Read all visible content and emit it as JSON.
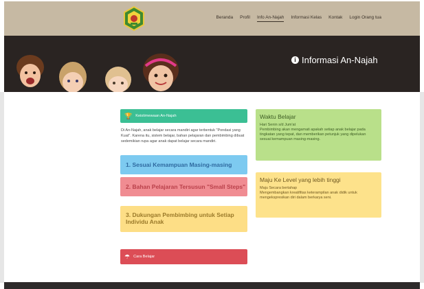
{
  "nav": {
    "items": [
      {
        "label": "Beranda",
        "active": false
      },
      {
        "label": "Profil",
        "active": false
      },
      {
        "label": "Info An-Najah",
        "active": true
      },
      {
        "label": "Informasi Kelas",
        "active": false
      },
      {
        "label": "Kontak",
        "active": false
      },
      {
        "label": "Login Orang tua",
        "active": false
      }
    ],
    "logo_icon": "school-logo-icon"
  },
  "hero": {
    "title": "Informasi An-Najah",
    "icon": "info-circle-icon"
  },
  "main": {
    "keunggulan_header": "Keistimewaan An-Najah",
    "description": "Di An-Najah, anak belajar secara mandiri agar terbentuk \"Pondasi yang Kuat\". Karena itu, sistem belajar, bahan pelajaran dan pembimbing dibuat sedemikian rupa agar anak dapat belajar secara mandiri.",
    "tabs": [
      {
        "label": "1. Sesuai Kemampuan Masing-masing"
      },
      {
        "label": "2. Bahan Pelajaran Tersusun \"Small Steps\""
      },
      {
        "label": "3. Dukungan Pembimbing untuk Setiap Individu Anak"
      }
    ],
    "cara_belajar_header": "Cara Belajar"
  },
  "cards": {
    "waktu": {
      "title": "Waktu Belajar",
      "subtitle": "Hari Senin s/d Jum'at",
      "body": "Pembimbing akan mengamati apakah setiap anak belajar pada tingkatan yang tepat, dan memberikan petunjuk yang dipelukan sesuai kemampuan masing-masing."
    },
    "level": {
      "title": "Maju Ke Level yang lebih tinggi",
      "subtitle": "Maju Secara bertahap",
      "body": "Mengembangkan kreatifitas keterampilan anak didik untuk mengekspresikan diri dalam berkarya seni."
    }
  },
  "colors": {
    "nav_bg": "#c6b9a3",
    "hero_bg": "#2a2422",
    "green_header": "#3bbf94",
    "blue_tab": "#7dcaf0",
    "pink_tab": "#f08c92",
    "yellow_tab": "#fdde86",
    "red_header": "#dc4d56",
    "card_green": "#b9e08a",
    "card_yellow": "#fde28b"
  }
}
